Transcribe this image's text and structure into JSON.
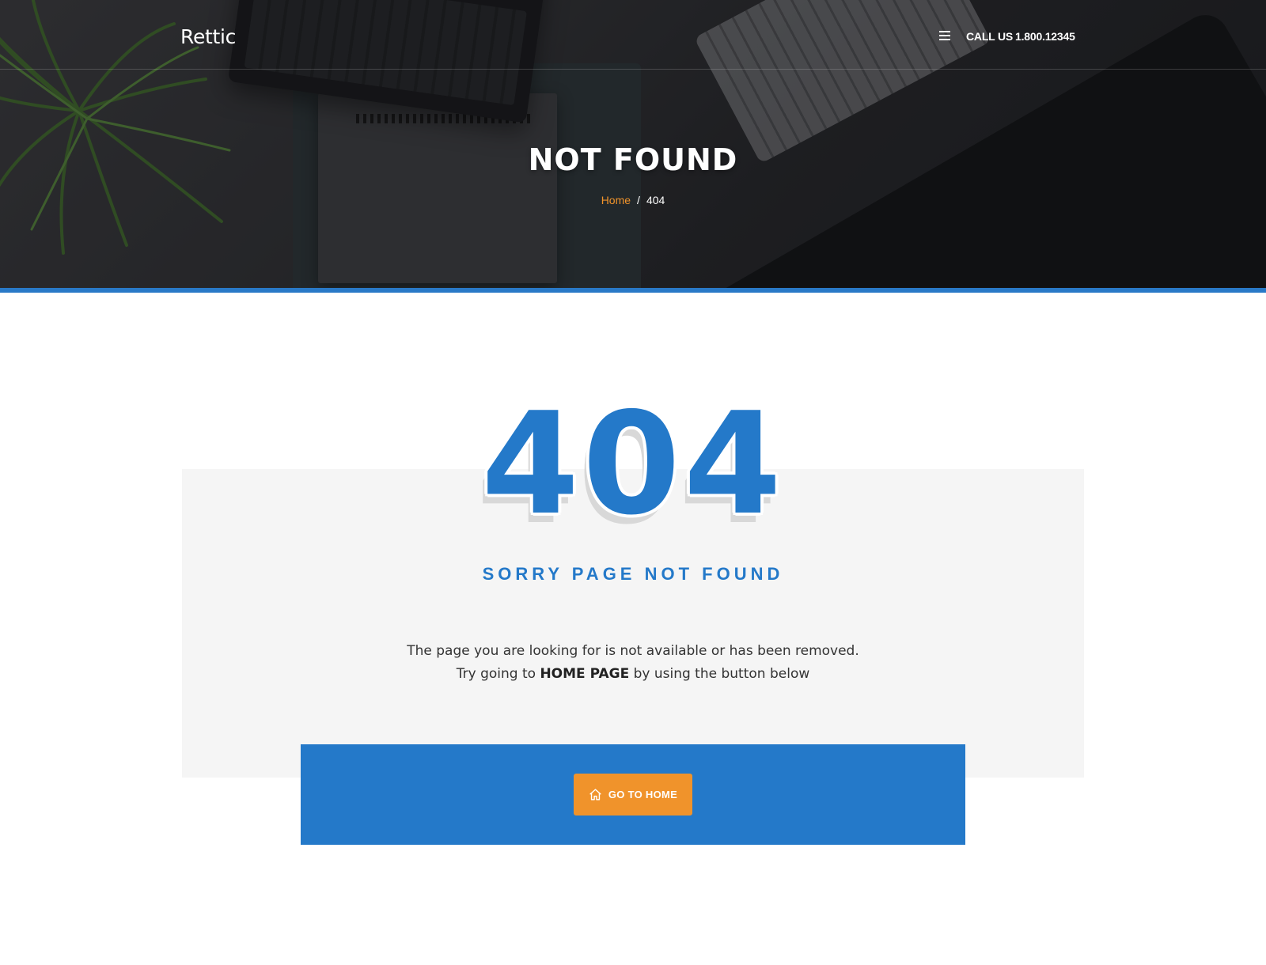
{
  "header": {
    "logo": "Rettic",
    "menu_icon": "bars-icon",
    "call_label": "CALL US",
    "call_number": "1.800.12345"
  },
  "hero": {
    "title": "NOT FOUND",
    "breadcrumb": {
      "home": "Home",
      "separator": "/",
      "current": "404"
    }
  },
  "error": {
    "code": "404",
    "heading": "SORRY PAGE NOT FOUND",
    "line1": "The page you are looking for is not available or has been removed.",
    "line2_prefix": "Try going to ",
    "line2_link": "HOME PAGE",
    "line2_suffix": " by using the button below"
  },
  "cta": {
    "button_label": "GO TO HOME",
    "button_icon": "home-icon"
  },
  "colors": {
    "primary_blue": "#2479c9",
    "accent_orange": "#f0932b",
    "panel_gray": "#f5f5f5"
  }
}
